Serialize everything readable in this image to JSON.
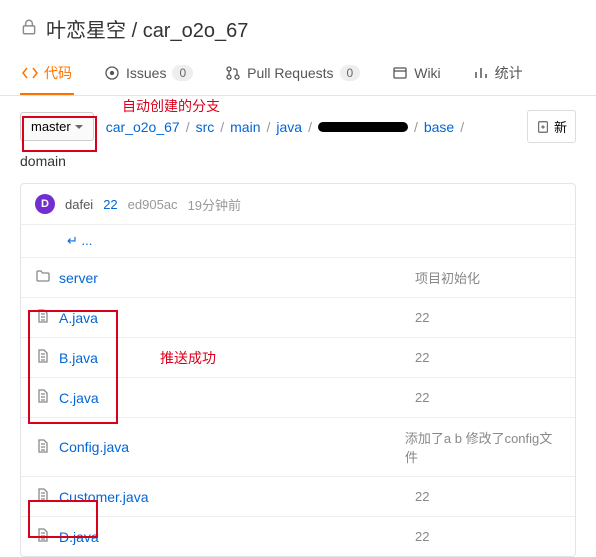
{
  "header": {
    "owner": "叶恋星空",
    "repo": "car_o2o_67"
  },
  "tabs": {
    "code": "代码",
    "issues": "Issues",
    "issues_count": "0",
    "pulls": "Pull Requests",
    "pulls_count": "0",
    "wiki": "Wiki",
    "stats": "统计"
  },
  "annotations": {
    "auto_branch": "自动创建的分支",
    "push_success": "推送成功"
  },
  "branch": {
    "current": "master"
  },
  "breadcrumb": {
    "root": "car_o2o_67",
    "p1": "src",
    "p2": "main",
    "p3": "java",
    "p5": "base",
    "last": "domain"
  },
  "new_button": "新",
  "commit": {
    "avatar_letter": "D",
    "user": "dafei",
    "msg": "22",
    "hash": "ed905ac",
    "time": "19分钟前"
  },
  "uplink": "↵ ...",
  "files": [
    {
      "type": "dir",
      "name": "server",
      "msg": "项目初始化"
    },
    {
      "type": "file",
      "name": "A.java",
      "msg": "22"
    },
    {
      "type": "file",
      "name": "B.java",
      "msg": "22"
    },
    {
      "type": "file",
      "name": "C.java",
      "msg": "22"
    },
    {
      "type": "file",
      "name": "Config.java",
      "msg": "添加了a b 修改了config文件"
    },
    {
      "type": "file",
      "name": "Customer.java",
      "msg": "22"
    },
    {
      "type": "file",
      "name": "D.java",
      "msg": "22"
    }
  ]
}
